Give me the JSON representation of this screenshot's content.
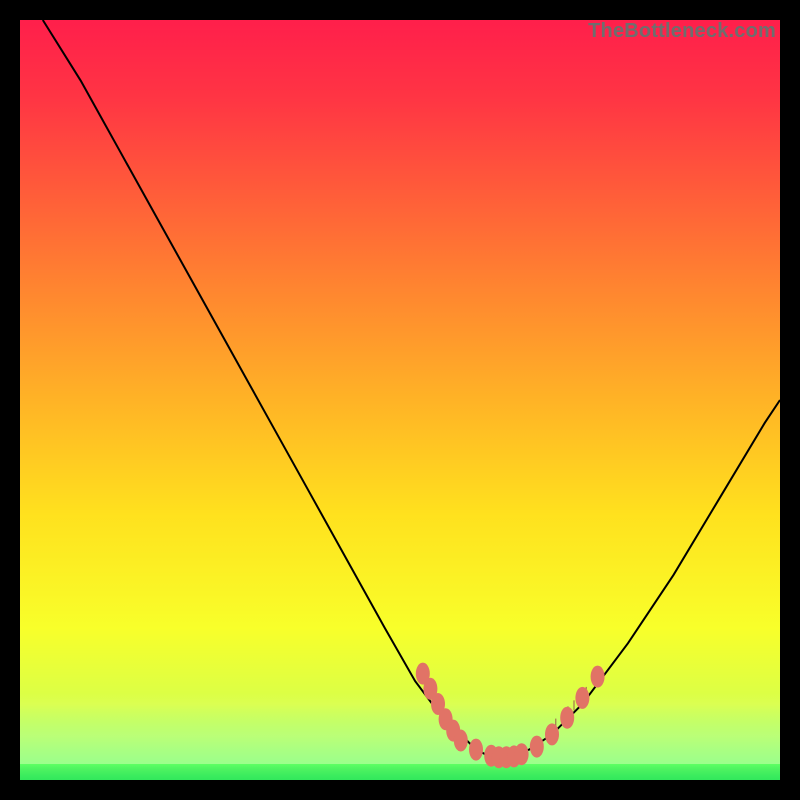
{
  "watermark": "TheBottleneck.com",
  "gradient": {
    "stops": [
      {
        "offset": 0.0,
        "color": "#ff1f4b"
      },
      {
        "offset": 0.1,
        "color": "#ff3444"
      },
      {
        "offset": 0.22,
        "color": "#ff5a3a"
      },
      {
        "offset": 0.35,
        "color": "#ff8430"
      },
      {
        "offset": 0.5,
        "color": "#ffb326"
      },
      {
        "offset": 0.65,
        "color": "#ffe11e"
      },
      {
        "offset": 0.8,
        "color": "#f8ff2a"
      },
      {
        "offset": 0.9,
        "color": "#d8ff49"
      },
      {
        "offset": 1.0,
        "color": "#3fff69"
      }
    ]
  },
  "chart_data": {
    "type": "line",
    "title": "",
    "xlabel": "",
    "ylabel": "",
    "xlim": [
      0,
      100
    ],
    "ylim": [
      0,
      100
    ],
    "series": [
      {
        "name": "bottleneck-curve",
        "x": [
          3,
          8,
          13,
          18,
          23,
          28,
          33,
          38,
          43,
          48,
          52,
          55,
          58,
          60,
          62,
          64,
          67,
          70,
          74,
          80,
          86,
          92,
          98,
          100
        ],
        "y": [
          100,
          92,
          83,
          74,
          65,
          56,
          47,
          38,
          29,
          20,
          13,
          9,
          6,
          4,
          3,
          3,
          4,
          6,
          10,
          18,
          27,
          37,
          47,
          50
        ]
      }
    ],
    "markers": {
      "name": "bottom-cluster",
      "color": "#e17366",
      "points": [
        {
          "x": 53,
          "y": 14
        },
        {
          "x": 54,
          "y": 12
        },
        {
          "x": 55,
          "y": 10
        },
        {
          "x": 56,
          "y": 8
        },
        {
          "x": 57,
          "y": 6.5
        },
        {
          "x": 58,
          "y": 5.2
        },
        {
          "x": 60,
          "y": 4.0
        },
        {
          "x": 62,
          "y": 3.2
        },
        {
          "x": 63,
          "y": 3.0
        },
        {
          "x": 64,
          "y": 3.0
        },
        {
          "x": 65,
          "y": 3.1
        },
        {
          "x": 66,
          "y": 3.4
        },
        {
          "x": 68,
          "y": 4.4
        },
        {
          "x": 70,
          "y": 6.0
        },
        {
          "x": 72,
          "y": 8.2
        },
        {
          "x": 74,
          "y": 10.8
        },
        {
          "x": 76,
          "y": 13.6
        }
      ]
    },
    "ticks": {
      "x_positions": [
        70.5,
        71.3,
        72.1,
        72.9,
        73.7,
        74.5
      ],
      "height": 3
    }
  }
}
